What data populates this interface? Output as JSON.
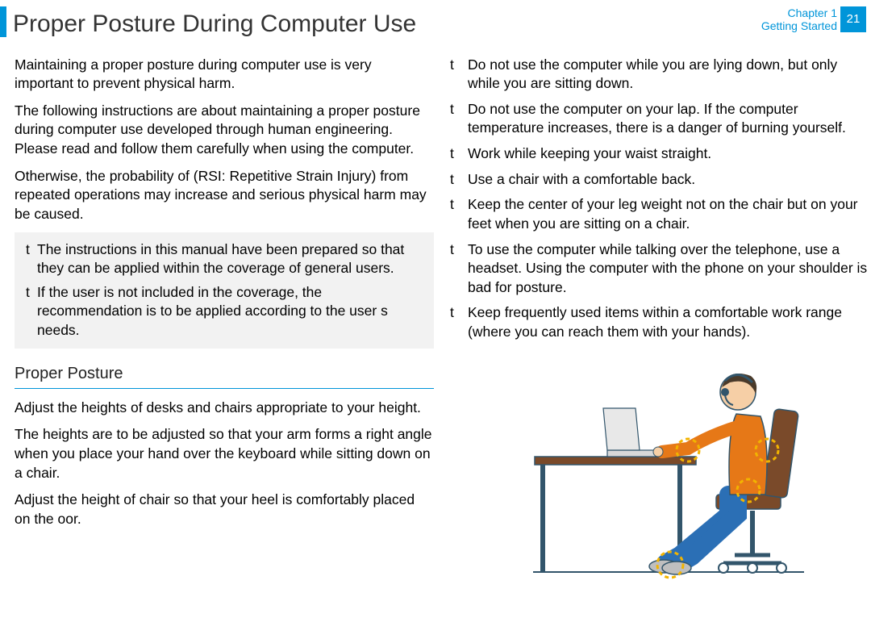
{
  "header": {
    "title": "Proper Posture During Computer Use",
    "chapter_line1": "Chapter 1",
    "chapter_line2": "Getting Started",
    "page": "21"
  },
  "left": {
    "p1": "Maintaining a proper posture during computer use is very important to prevent physical harm.",
    "p2": "The following instructions are about maintaining a proper posture during computer use developed through human engineering. Please read and follow them carefully when using the computer.",
    "p3": "Otherwise, the probability of (RSI: Repetitive Strain Injury) from repeated operations may increase and serious physical harm may be caused.",
    "note1": "The instructions in this manual have been prepared so that they can be applied within the coverage of general users.",
    "note2": "If the user is not included in the coverage, the recommendation is to be applied according to the user s needs.",
    "section": "Proper Posture",
    "p4": "Adjust the heights of desks and chairs appropriate to your height.",
    "p5": "The heights are to be adjusted so that your arm forms a right angle when you place your hand over the keyboard while sitting down on a chair.",
    "p6": "Adjust the height of chair so that your heel is comfortably placed on the  oor."
  },
  "right": {
    "b1": "Do not use the computer while you are lying down, but only while you are sitting down.",
    "b2": "Do not use the computer on your lap. If the computer temperature increases, there is a danger of burning yourself.",
    "b3": "Work while keeping your waist straight.",
    "b4": "Use a chair with a comfortable back.",
    "b5": "Keep the center of your leg weight not on the chair but on your feet when you are sitting on a chair.",
    "b6": "To use the computer while talking over the telephone, use a headset. Using the computer with the phone on your shoulder is bad for posture.",
    "b7": "Keep frequently used items within a comfortable work range (where you can reach them with your hands)."
  },
  "marks": {
    "t": "t"
  }
}
